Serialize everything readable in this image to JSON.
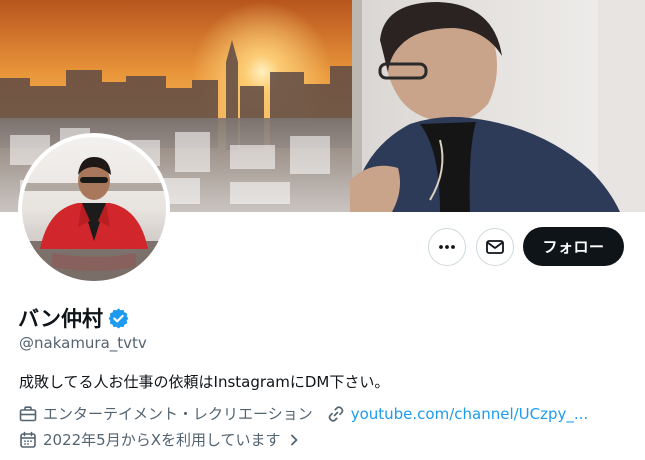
{
  "profile": {
    "display_name": "バン仲村",
    "handle": "@nakamura_tvtv",
    "bio": "成敗してる人お仕事の依頼はInstagramにDM下さい。",
    "category": "エンターテイメント・レクリエーション",
    "website": "youtube.com/channel/UCzpy_...",
    "joined": "2022年5月からXを利用しています",
    "verified": true
  },
  "actions": {
    "follow_label": "フォロー",
    "more_icon": "more-icon",
    "dm_icon": "mail-icon"
  },
  "icons": {
    "verified": "verified-badge-icon",
    "category": "briefcase-icon",
    "website": "link-icon",
    "joined": "calendar-icon",
    "chevron": "chevron-right-icon"
  },
  "colors": {
    "text_primary": "#0f1419",
    "text_secondary": "#536471",
    "link": "#1d9bf0",
    "verified": "#1d9bf0",
    "follow_bg": "#0f1419",
    "button_border": "#cfd9de"
  }
}
